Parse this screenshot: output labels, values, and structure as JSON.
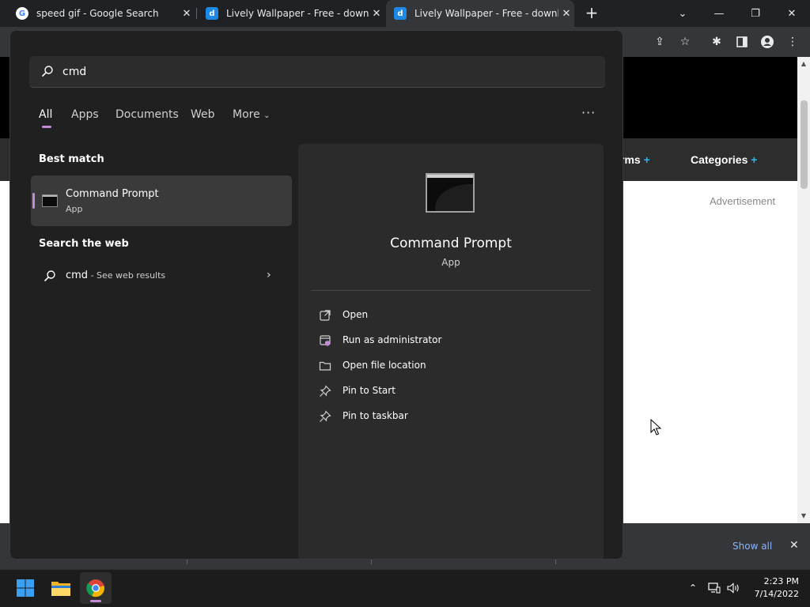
{
  "browser": {
    "tabs": [
      {
        "title": "speed gif - Google Search",
        "favicon": "google-icon"
      },
      {
        "title": "Lively Wallpaper - Free - downlo",
        "favicon": "lively-wallpaper-icon"
      },
      {
        "title": "Lively Wallpaper - Free - downlo",
        "favicon": "lively-wallpaper-icon"
      }
    ],
    "active_tab": 2
  },
  "webpage": {
    "nav": {
      "item_1": "rms",
      "item_2": "Categories",
      "plus": "+"
    },
    "ad_label": "Advertisement"
  },
  "download_bar": {
    "show_all": "Show all"
  },
  "search": {
    "query": "cmd",
    "filters": [
      "All",
      "Apps",
      "Documents",
      "Web",
      "More"
    ],
    "active_filter": "All",
    "best_match_heading": "Best match",
    "best_match": {
      "title": "Command Prompt",
      "subtitle": "App"
    },
    "web_heading": "Search the web",
    "web_result": {
      "query": "cmd",
      "suffix": " - See web results"
    }
  },
  "preview": {
    "title": "Command Prompt",
    "subtitle": "App",
    "actions": [
      {
        "label": "Open",
        "icon": "open-external-icon"
      },
      {
        "label": "Run as administrator",
        "icon": "shield-admin-icon"
      },
      {
        "label": "Open file location",
        "icon": "folder-icon"
      },
      {
        "label": "Pin to Start",
        "icon": "pin-icon"
      },
      {
        "label": "Pin to taskbar",
        "icon": "pin-icon"
      }
    ]
  },
  "taskbar": {
    "clock": {
      "time": "2:23 PM",
      "date": "7/14/2022"
    }
  },
  "colors": {
    "accent": "#c28bd8",
    "link": "#8ab4f8",
    "nav_plus": "#29b6f6"
  }
}
